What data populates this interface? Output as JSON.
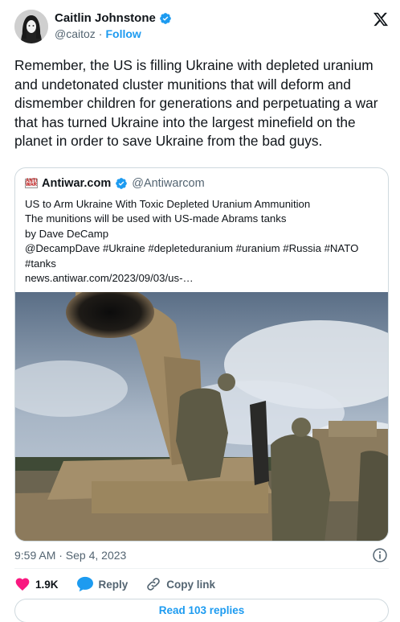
{
  "author": {
    "display_name": "Caitlin Johnstone",
    "handle": "@caitoz",
    "separator": "·",
    "follow_label": "Follow",
    "verified": true
  },
  "tweet": {
    "text": "Remember, the US is filling Ukraine with depleted uranium and undetonated cluster munitions that will deform and dismember children for generations and perpetuating a war that has turned Ukraine into the largest minefield on the planet in order to save Ukraine from the bad guys."
  },
  "quoted": {
    "display_name": "Antiwar.com",
    "handle": "@Antiwarcom",
    "logo_text": "ANTI WAR",
    "lines": [
      "US to Arm Ukraine With Toxic Depleted Uranium Ammunition",
      "The munitions will be used with US-made Abrams tanks",
      "by Dave DeCamp",
      "@DecampDave #Ukraine #depleteduranium #uranium #Russia #NATO",
      "#tanks",
      "news.antiwar.com/2023/09/03/us-…"
    ]
  },
  "footer": {
    "timestamp": "9:59 AM · Sep 4, 2023",
    "likes": "1.9K",
    "reply_label": "Reply",
    "copy_link_label": "Copy link",
    "read_replies_label": "Read 103 replies"
  },
  "colors": {
    "accent": "#1d9bf0",
    "like": "#f91880",
    "text": "#0f1419",
    "secondary": "#536471"
  }
}
